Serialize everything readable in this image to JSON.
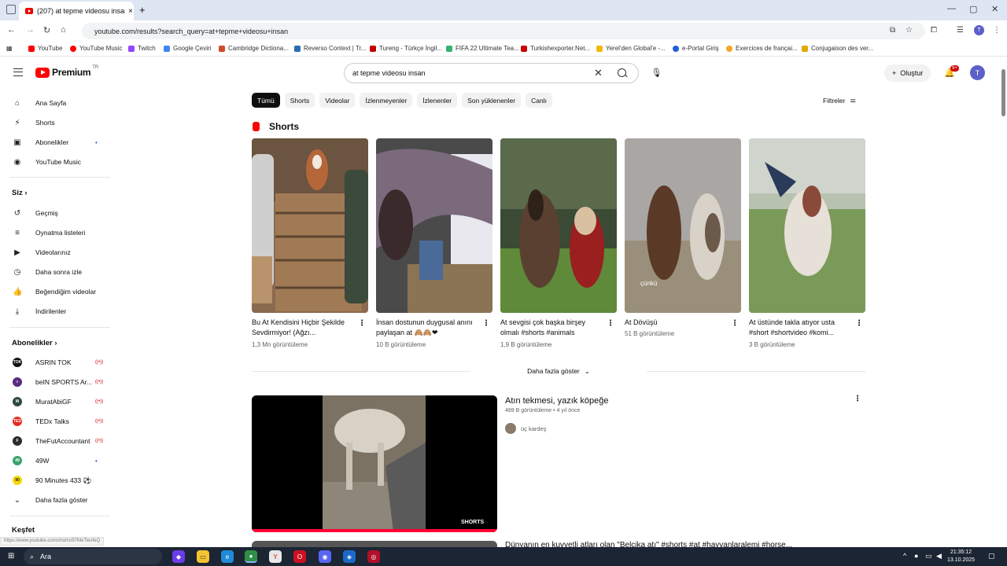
{
  "browser": {
    "tab_title": "(207) at tepme videosu insan",
    "tab_close": "×",
    "new_tab": "+",
    "window_controls": [
      "—",
      "▢",
      "✕"
    ],
    "url": "youtube.com/results?search_query=at+tepme+videosu+insan",
    "bookmarks": [
      {
        "label": "YouTube",
        "color": "#ff0000"
      },
      {
        "label": "YouTube Music",
        "color": "#ff0000"
      },
      {
        "label": "Twitch",
        "color": "#9146ff"
      },
      {
        "label": "Google Çeviri",
        "color": "#4285f4"
      },
      {
        "label": "Cambridge Dictiona...",
        "color": "#d04a2e"
      },
      {
        "label": "Reverso Context | Tr...",
        "color": "#2b6cb0"
      },
      {
        "label": "Tureng - Türkçe İngil...",
        "color": "#c00000"
      },
      {
        "label": "FIFA 22 Ultimate Tea...",
        "color": "#38b26e"
      },
      {
        "label": "Turkishexporter.Net...",
        "color": "#cc0000"
      },
      {
        "label": "Yerel'den Global'e -...",
        "color": "#f2b705"
      },
      {
        "label": "e-Portal Giriş",
        "color": "#1f5fd6"
      },
      {
        "label": "Exercices de françai...",
        "color": "#f5a623"
      },
      {
        "label": "Conjugaison des ver...",
        "color": "#e0a800"
      }
    ]
  },
  "header": {
    "logo_text": "Premium",
    "logo_region": "TR",
    "search_query": "at tepme videosu insan",
    "clear_symbol": "✕",
    "create_label": "Oluştur",
    "notif_badge": "9+",
    "avatar_letter": "T"
  },
  "sidebar": {
    "main": [
      {
        "label": "Ana Sayfa",
        "icon": "⌂"
      },
      {
        "label": "Shorts",
        "icon": "⚡"
      },
      {
        "label": "Abonelikler",
        "icon": "▣",
        "dot": "•"
      },
      {
        "label": "YouTube Music",
        "icon": "◉"
      }
    ],
    "you_head": "Siz  ›",
    "you": [
      {
        "label": "Geçmiş",
        "icon": "↺"
      },
      {
        "label": "Oynatma listeleri",
        "icon": "≡"
      },
      {
        "label": "Videolarınız",
        "icon": "▶"
      },
      {
        "label": "Daha sonra izle",
        "icon": "◷"
      },
      {
        "label": "Beğendiğim videolar",
        "icon": "👍"
      },
      {
        "label": "İndirilenler",
        "icon": "⤓"
      }
    ],
    "subs_head": "Abonelikler  ›",
    "subs": [
      {
        "label": "ASRIN TOK",
        "color": "#111111",
        "mark": "TOK",
        "dot": "((•))"
      },
      {
        "label": "beIN SPORTS Ar...",
        "color": "#5a2a82",
        "mark": "≡",
        "dot": "((•))"
      },
      {
        "label": "MuratAbiGF",
        "color": "#2e4a3c",
        "mark": "M",
        "dot": "((•))"
      },
      {
        "label": "TEDx Talks",
        "color": "#e62b1e",
        "mark": "TED",
        "dot": "((•))"
      },
      {
        "label": "TheFutAccountant",
        "color": "#2b2b2b",
        "mark": "F",
        "dot": "((•))"
      },
      {
        "label": "49W",
        "color": "#3aa36b",
        "mark": "49",
        "dot": "•"
      },
      {
        "label": "90 Minutes 433 ⚽",
        "color": "#f5d90a",
        "mark": "90",
        "dot": ""
      }
    ],
    "show_more": "Daha fazla göster",
    "explore": "Keşfet"
  },
  "chips": [
    "Tümü",
    "Shorts",
    "Videolar",
    "İzlenmeyenler",
    "İzlenenler",
    "Son yüklenenler",
    "Canlı"
  ],
  "filters_label": "Filtreler",
  "shorts_heading": "Shorts",
  "shorts": [
    {
      "title": "Bu At Kendisini Hiçbir Şekilde Sevdirmiyor! (Ağzı...",
      "views": "1,3 Mn görüntüleme"
    },
    {
      "title": "İnsan dostunun duygusal anını paylaşan at 🙈🙈❤",
      "views": "10 B görüntüleme"
    },
    {
      "title": "At sevgisi çok başka birşey olmalı #shorts #animals",
      "views": "1,9 B görüntüleme"
    },
    {
      "title": "At Dövüşü",
      "views": "51 B görüntüleme",
      "overlay": "çünkü"
    },
    {
      "title": "At üstünde takla atıyor usta #short #shortvideo #komi...",
      "views": "3 B görüntüleme"
    }
  ],
  "show_more_shorts": "Daha fazla göster",
  "video": {
    "title": "Atın tekmesi, yazık köpeğe",
    "meta": "489 B görüntüleme • 4 yıl önce",
    "channel": "üç kardeş",
    "badge": "SHORTS"
  },
  "next_video_title": "Dünyanın en kuvvetli atları olan \"Belçika atı\" #shorts #at #hayvanlaralemi #horse...",
  "status_url": "https://www.youtube.com/shorts/97MeTiesfeQ",
  "taskbar": {
    "search_label": "Ara",
    "time": "21:35:12",
    "date": "13.10.2025"
  }
}
